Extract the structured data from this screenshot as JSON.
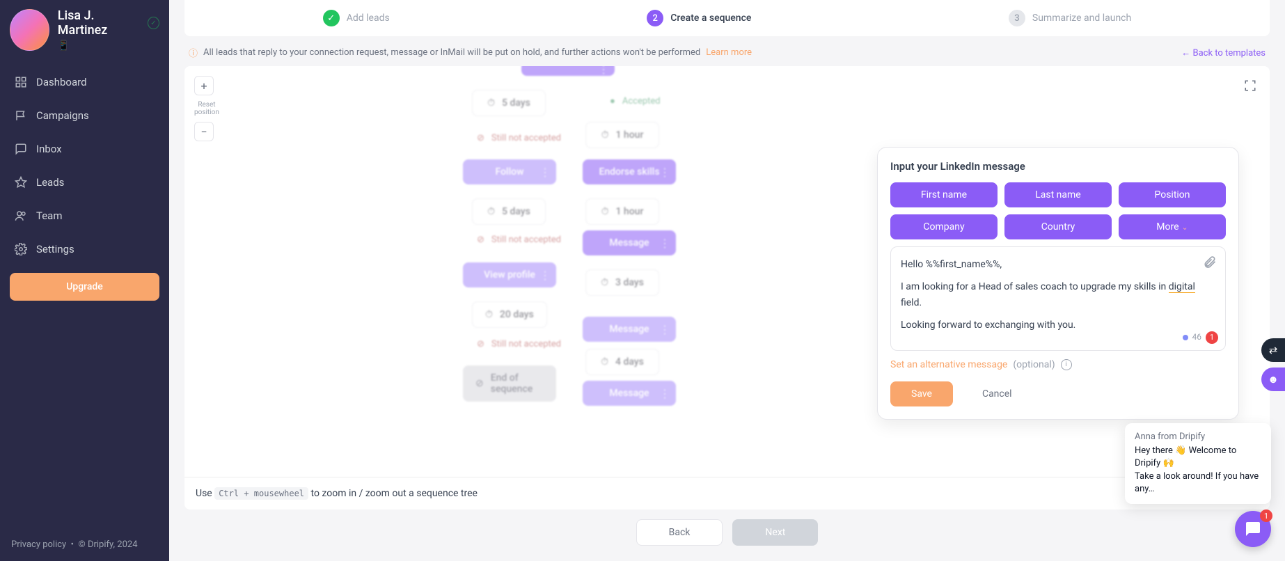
{
  "profile": {
    "name": "Lisa J. Martinez",
    "emoji": "📱"
  },
  "nav": {
    "dashboard": "Dashboard",
    "campaigns": "Campaigns",
    "inbox": "Inbox",
    "leads": "Leads",
    "team": "Team",
    "settings": "Settings",
    "upgrade": "Upgrade"
  },
  "footer": {
    "privacy": "Privacy policy",
    "sep": "•",
    "copyright": "© Dripify, 2024"
  },
  "steps": {
    "s1": "Add leads",
    "s2": "Create a sequence",
    "s3": "Summarize and launch",
    "n2": "2",
    "n3": "3"
  },
  "notice": {
    "text": "All leads that reply to your connection request, message or InMail will be put on hold, and further actions won't be performed ",
    "learn": "Learn more",
    "back": "← Back to templates"
  },
  "zoom": {
    "label1": "Reset",
    "label2": "position"
  },
  "nodes": {
    "d5a": "5 days",
    "d5b": "5 days",
    "d1h_a": "1 hour",
    "d1h_b": "1 hour",
    "d3": "3 days",
    "d20": "20 days",
    "d4": "4 days",
    "follow": "Follow",
    "endorse": "Endorse skills",
    "message": "Message",
    "viewprofile": "View profile",
    "message2": "Message",
    "message3": "Message",
    "eos": "End of sequence",
    "sna": "Still not accepted",
    "snb": "Still not accepted",
    "snc": "Still not accepted",
    "acc": "Accepted"
  },
  "panel": {
    "title": "Input your LinkedIn message",
    "chips": {
      "first": "First name",
      "last": "Last name",
      "position": "Position",
      "company": "Company",
      "country": "Country",
      "more": "More"
    },
    "msg_line1": "Hello %%first_name%%,",
    "msg_line2_a": "I am looking for a Head of sales coach to upgrade my skills in ",
    "msg_line2_b": "digital",
    "msg_line2_c": " field.",
    "msg_line3": "Looking forward to exchanging with you.",
    "count": "46",
    "count_badge": "1",
    "alt": "Set an alternative message",
    "opt": "(optional)",
    "save": "Save",
    "cancel": "Cancel"
  },
  "tip": {
    "a": "Use ",
    "code": "Ctrl + mousewheel",
    "b": " to zoom in / zoom out a sequence tree"
  },
  "navbtn": {
    "back": "Back",
    "next": "Next"
  },
  "chat": {
    "from": "Anna from Dripify",
    "line1": "Hey there 👋 Welcome to Dripify 🙌",
    "line2": "Take a look around! If you have any…",
    "badge": "1"
  }
}
